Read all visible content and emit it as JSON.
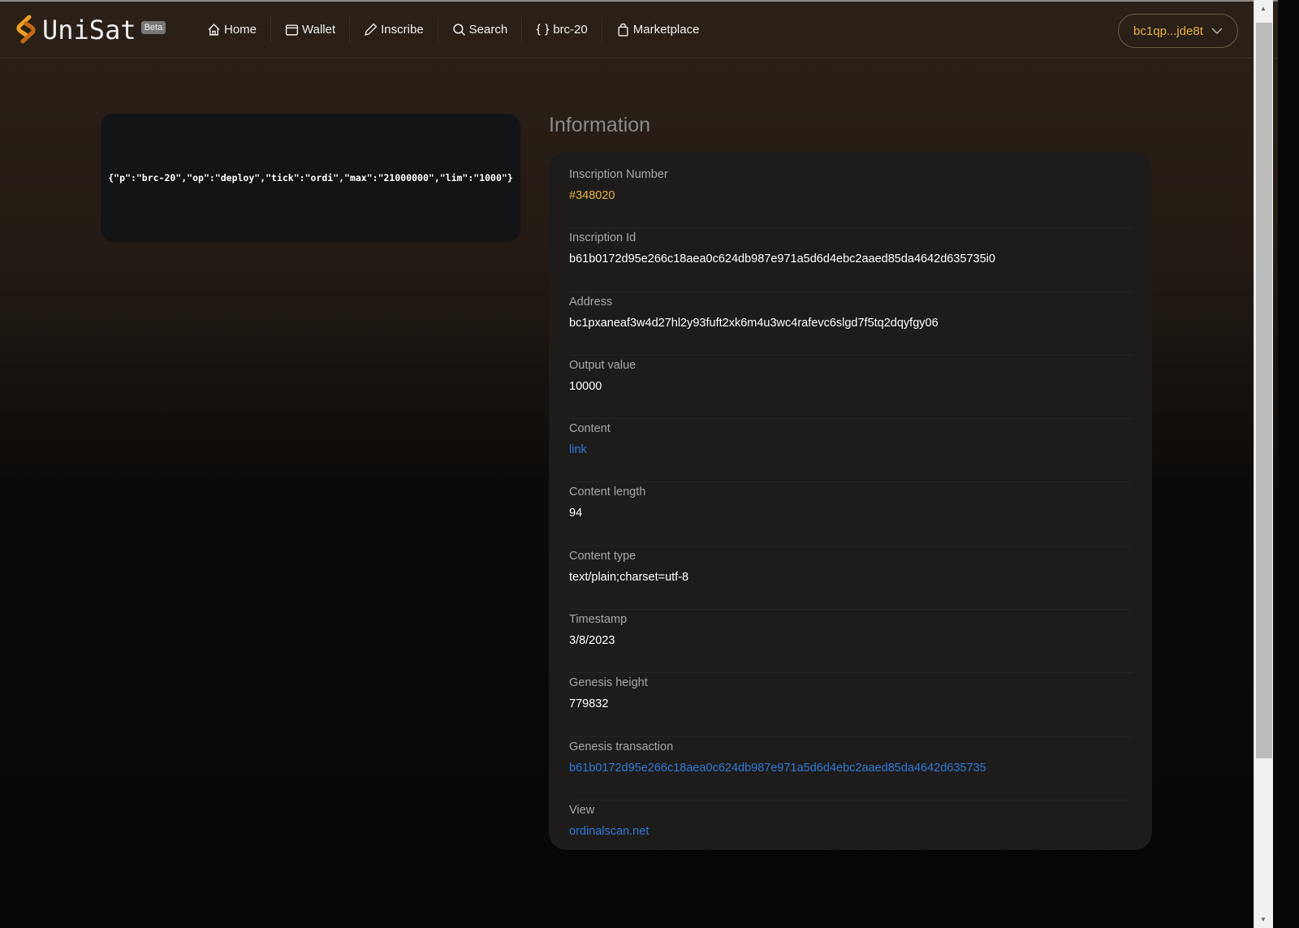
{
  "header": {
    "brand": "UniSat",
    "beta": "Beta",
    "nav": [
      {
        "label": "Home",
        "icon": "home-icon"
      },
      {
        "label": "Wallet",
        "icon": "wallet-icon"
      },
      {
        "label": "Inscribe",
        "icon": "pencil-icon"
      },
      {
        "label": "Search",
        "icon": "search-icon"
      },
      {
        "label": "brc-20",
        "icon": "braces-icon"
      },
      {
        "label": "Marketplace",
        "icon": "bag-icon"
      }
    ],
    "wallet_address": "bc1qp...jde8t"
  },
  "preview": {
    "content": "{\"p\":\"brc-20\",\"op\":\"deploy\",\"tick\":\"ordi\",\"max\":\"21000000\",\"lim\":\"1000\"}"
  },
  "info": {
    "title": "Information",
    "rows": [
      {
        "label": "Inscription Number",
        "value": "#348020"
      },
      {
        "label": "Inscription Id",
        "value": "b61b0172d95e266c18aea0c624db987e971a5d6d4ebc2aaed85da4642d635735i0"
      },
      {
        "label": "Address",
        "value": "bc1pxaneaf3w4d27hl2y93fuft2xk6m4u3wc4rafevc6slgd7f5tq2dqyfgy06"
      },
      {
        "label": "Output value",
        "value": "10000"
      },
      {
        "label": "Content",
        "value": "link"
      },
      {
        "label": "Content length",
        "value": "94"
      },
      {
        "label": "Content type",
        "value": "text/plain;charset=utf-8"
      },
      {
        "label": "Timestamp",
        "value": "3/8/2023"
      },
      {
        "label": "Genesis height",
        "value": "779832"
      },
      {
        "label": "Genesis transaction",
        "value": "b61b0172d95e266c18aea0c624db987e971a5d6d4ebc2aaed85da4642d635735"
      },
      {
        "label": "View",
        "value": "ordinalscan.net"
      }
    ]
  },
  "colors": {
    "accent": "#e6b23a",
    "link": "#2f78d6"
  }
}
